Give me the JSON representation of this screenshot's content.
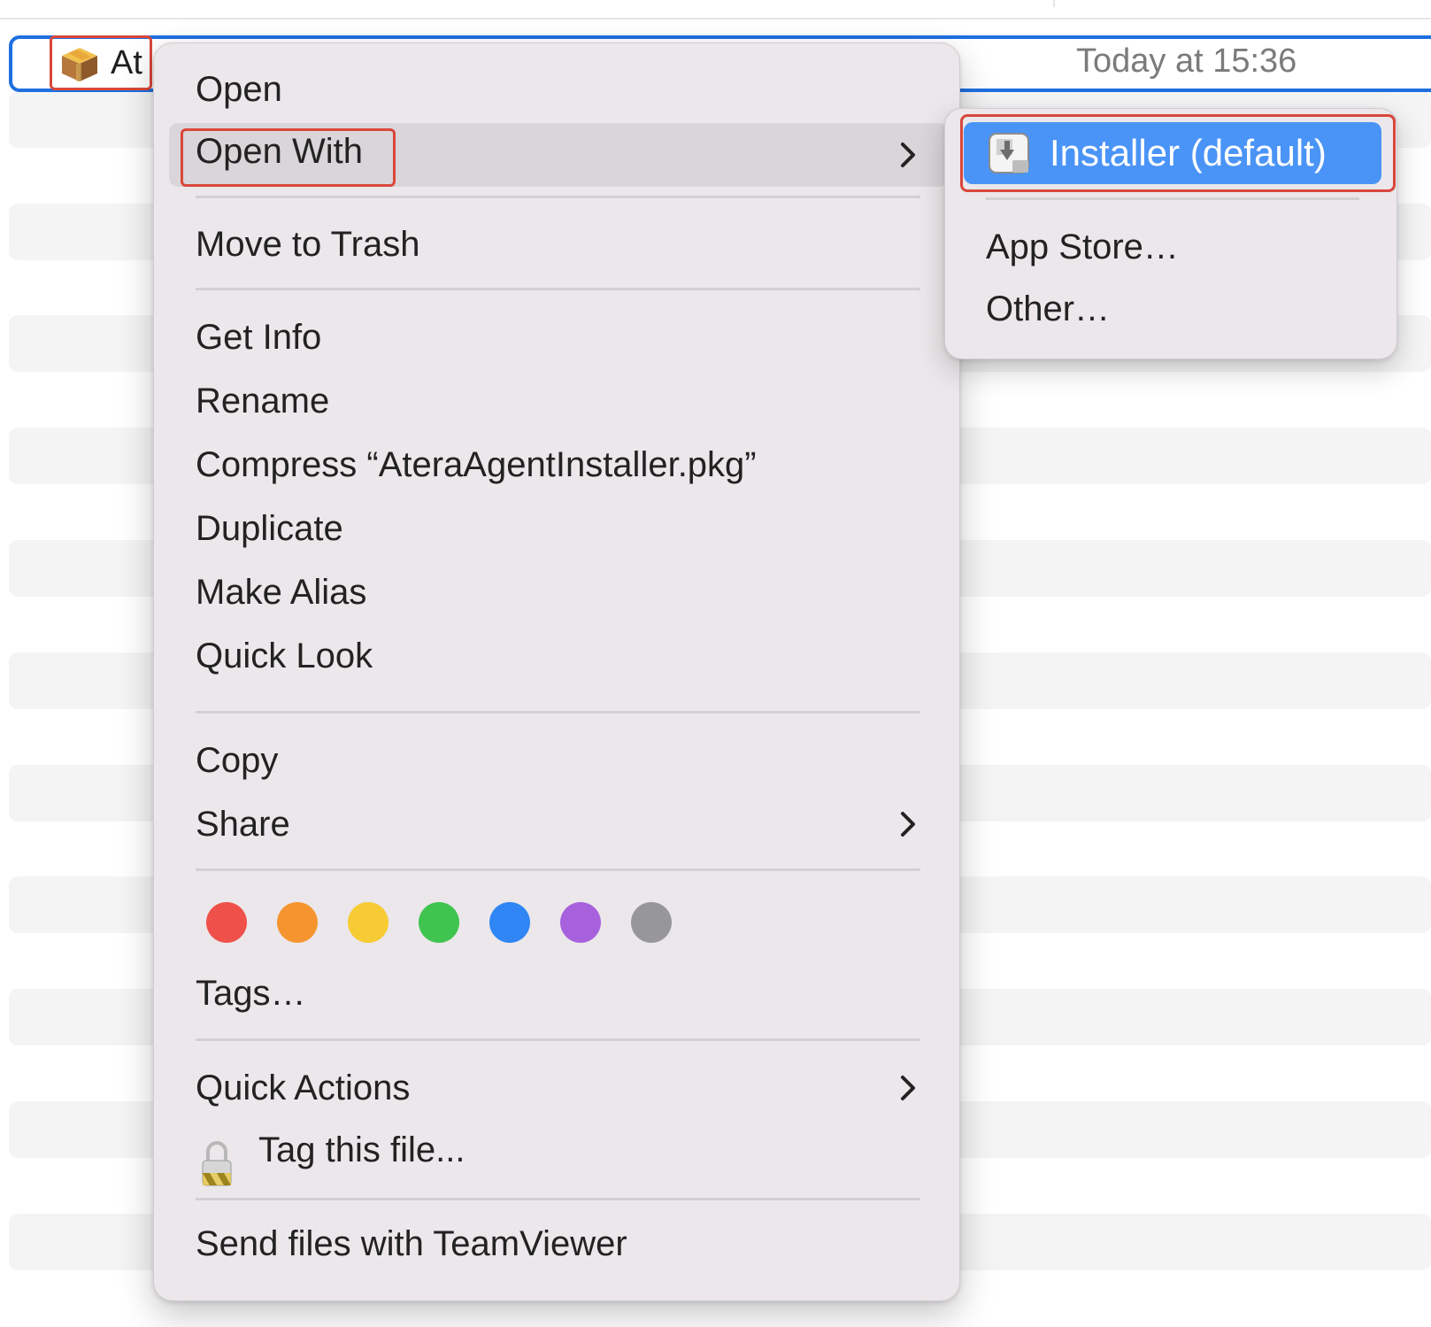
{
  "finder": {
    "file_name_visible": "At",
    "date_modified": "Today at 15:36",
    "file_icon": "package-icon"
  },
  "context_menu": {
    "open": "Open",
    "open_with": "Open With",
    "move_to_trash": "Move to Trash",
    "get_info": "Get Info",
    "rename": "Rename",
    "compress": "Compress “AteraAgentInstaller.pkg”",
    "duplicate": "Duplicate",
    "make_alias": "Make Alias",
    "quick_look": "Quick Look",
    "copy": "Copy",
    "share": "Share",
    "tag_colors": [
      "#f0504a",
      "#f6952f",
      "#f7cb33",
      "#3ec44f",
      "#2f86f4",
      "#a861dc",
      "#97979b"
    ],
    "tags": "Tags…",
    "quick_actions": "Quick Actions",
    "tag_this_file": "Tag this file...",
    "send_teamviewer": "Send files with TeamViewer"
  },
  "open_with_submenu": {
    "installer_default": "Installer (default)",
    "app_store": "App Store…",
    "other": "Other…"
  },
  "colors": {
    "highlight": "#4a94f7",
    "selection_border": "#1f6fe0",
    "annotation_box": "#d9473b"
  }
}
